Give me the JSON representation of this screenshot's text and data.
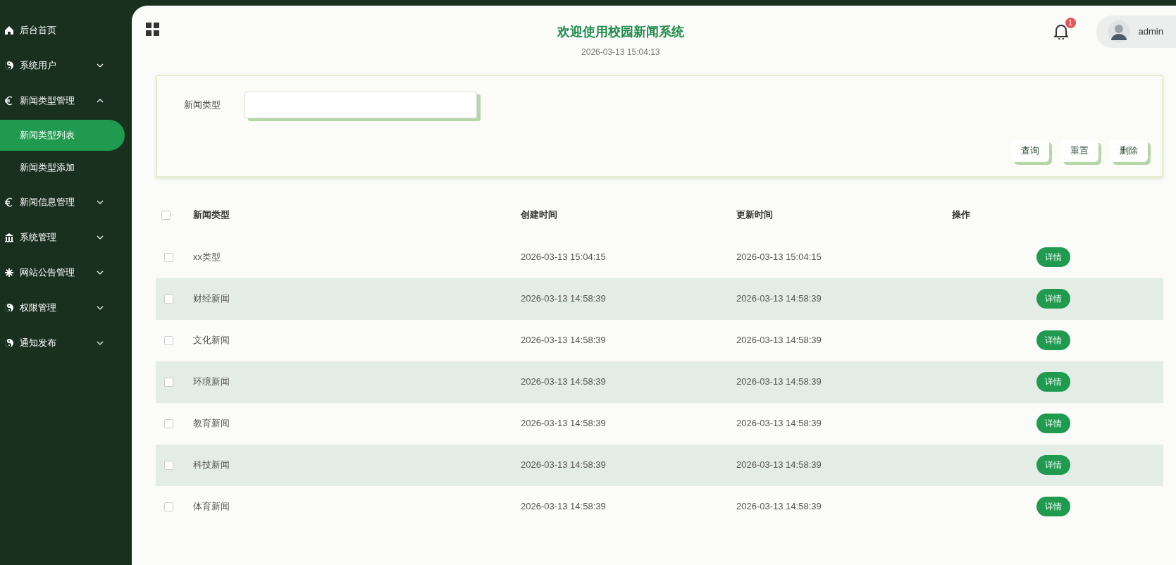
{
  "sidebar": {
    "items": [
      {
        "kind": "home",
        "label": "后台首页"
      },
      {
        "kind": "yinyang",
        "label": "系统用户",
        "expanded": false
      },
      {
        "kind": "euro",
        "label": "新闻类型管理",
        "expanded": true,
        "children": [
          {
            "label": "新闻类型列表",
            "selected": true
          },
          {
            "label": "新闻类型添加",
            "selected": false
          }
        ]
      },
      {
        "kind": "euro",
        "label": "新闻信息管理",
        "expanded": false
      },
      {
        "kind": "bank",
        "label": "系统管理",
        "expanded": false
      },
      {
        "kind": "asterisk",
        "label": "网站公告管理",
        "expanded": false
      },
      {
        "kind": "yinyang",
        "label": "权限管理",
        "expanded": false
      },
      {
        "kind": "yinyang",
        "label": "通知发布",
        "expanded": false
      }
    ]
  },
  "header": {
    "title": "欢迎使用校园新闻系统",
    "datetime": "2026-03-13 15:04:13",
    "notification_count": "1",
    "user": "admin"
  },
  "search": {
    "label": "新闻类型",
    "buttons": [
      "查询",
      "重置",
      "删除"
    ]
  },
  "table": {
    "columns": [
      "新闻类型",
      "创建时间",
      "更新时间",
      "操作"
    ],
    "all_checked": false,
    "rows": [
      {
        "checked": false,
        "type": "xx类型",
        "created": "2026-03-13 15:04:15",
        "updated": "2026-03-13 15:04:15",
        "action": "详情"
      },
      {
        "checked": false,
        "type": "财经新闻",
        "created": "2026-03-13 14:58:39",
        "updated": "2026-03-13 14:58:39",
        "action": "详情"
      },
      {
        "checked": false,
        "type": "文化新闻",
        "created": "2026-03-13 14:58:39",
        "updated": "2026-03-13 14:58:39",
        "action": "详情"
      },
      {
        "checked": false,
        "type": "环境新闻",
        "created": "2026-03-13 14:58:39",
        "updated": "2026-03-13 14:58:39",
        "action": "详情"
      },
      {
        "checked": false,
        "type": "教育新闻",
        "created": "2026-03-13 14:58:39",
        "updated": "2026-03-13 14:58:39",
        "action": "详情"
      },
      {
        "checked": false,
        "type": "科技新闻",
        "created": "2026-03-13 14:58:39",
        "updated": "2026-03-13 14:58:39",
        "action": "详情"
      },
      {
        "checked": false,
        "type": "体育新闻",
        "created": "2026-03-13 14:58:39",
        "updated": "2026-03-13 14:58:39",
        "action": "详情"
      }
    ]
  }
}
